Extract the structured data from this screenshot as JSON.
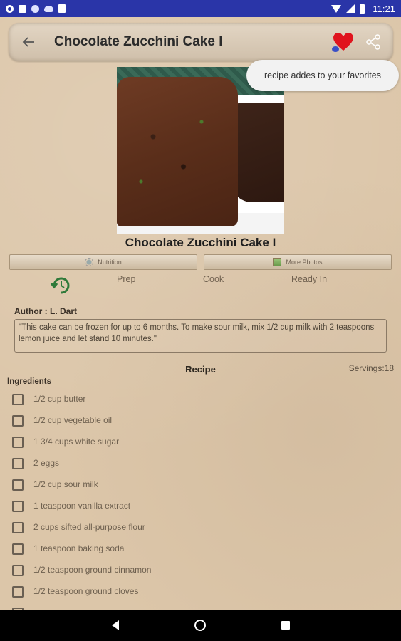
{
  "status_bar": {
    "time": "11:21",
    "icons": [
      "gear-icon",
      "a-icon",
      "circle-icon",
      "cloud-icon",
      "sd-card-icon",
      "wifi-icon",
      "signal-icon",
      "battery-icon"
    ]
  },
  "toolbar": {
    "title": "Chocolate Zucchini Cake I",
    "back_icon": "arrow-left-icon",
    "favorite_icon": "heart-icon",
    "share_icon": "share-icon",
    "favorite_color": "#e0141e"
  },
  "toast": {
    "text": "recipe addes to your favorites"
  },
  "recipe": {
    "title": "Chocolate Zucchini Cake I",
    "tabs": [
      {
        "label": "Nutrition",
        "icon": "nutrition-icon"
      },
      {
        "label": "More Photos",
        "icon": "photos-icon"
      }
    ],
    "times": {
      "prep_label": "Prep",
      "cook_label": "Cook",
      "ready_label": "Ready In"
    },
    "author": "Author : L. Dart",
    "description": "\"This cake can be frozen for up to 6 months. To make sour milk, mix 1/2 cup milk with 2 teaspoons lemon juice and let stand 10 minutes.\"",
    "recipe_heading": "Recipe",
    "servings": "Servings:18",
    "ingredients_label": "Ingredients",
    "ingredients": [
      "1/2 cup butter",
      "1/2 cup vegetable oil",
      "1 3/4 cups white sugar",
      "2 eggs",
      "1/2 cup sour milk",
      "1 teaspoon vanilla extract",
      "2 cups sifted all-purpose flour",
      "1 teaspoon baking soda",
      "1/2 teaspoon ground cinnamon",
      "1/2 teaspoon ground cloves"
    ]
  },
  "nav_bar": {
    "icons": [
      "nav-back-icon",
      "nav-home-icon",
      "nav-recent-icon"
    ]
  }
}
